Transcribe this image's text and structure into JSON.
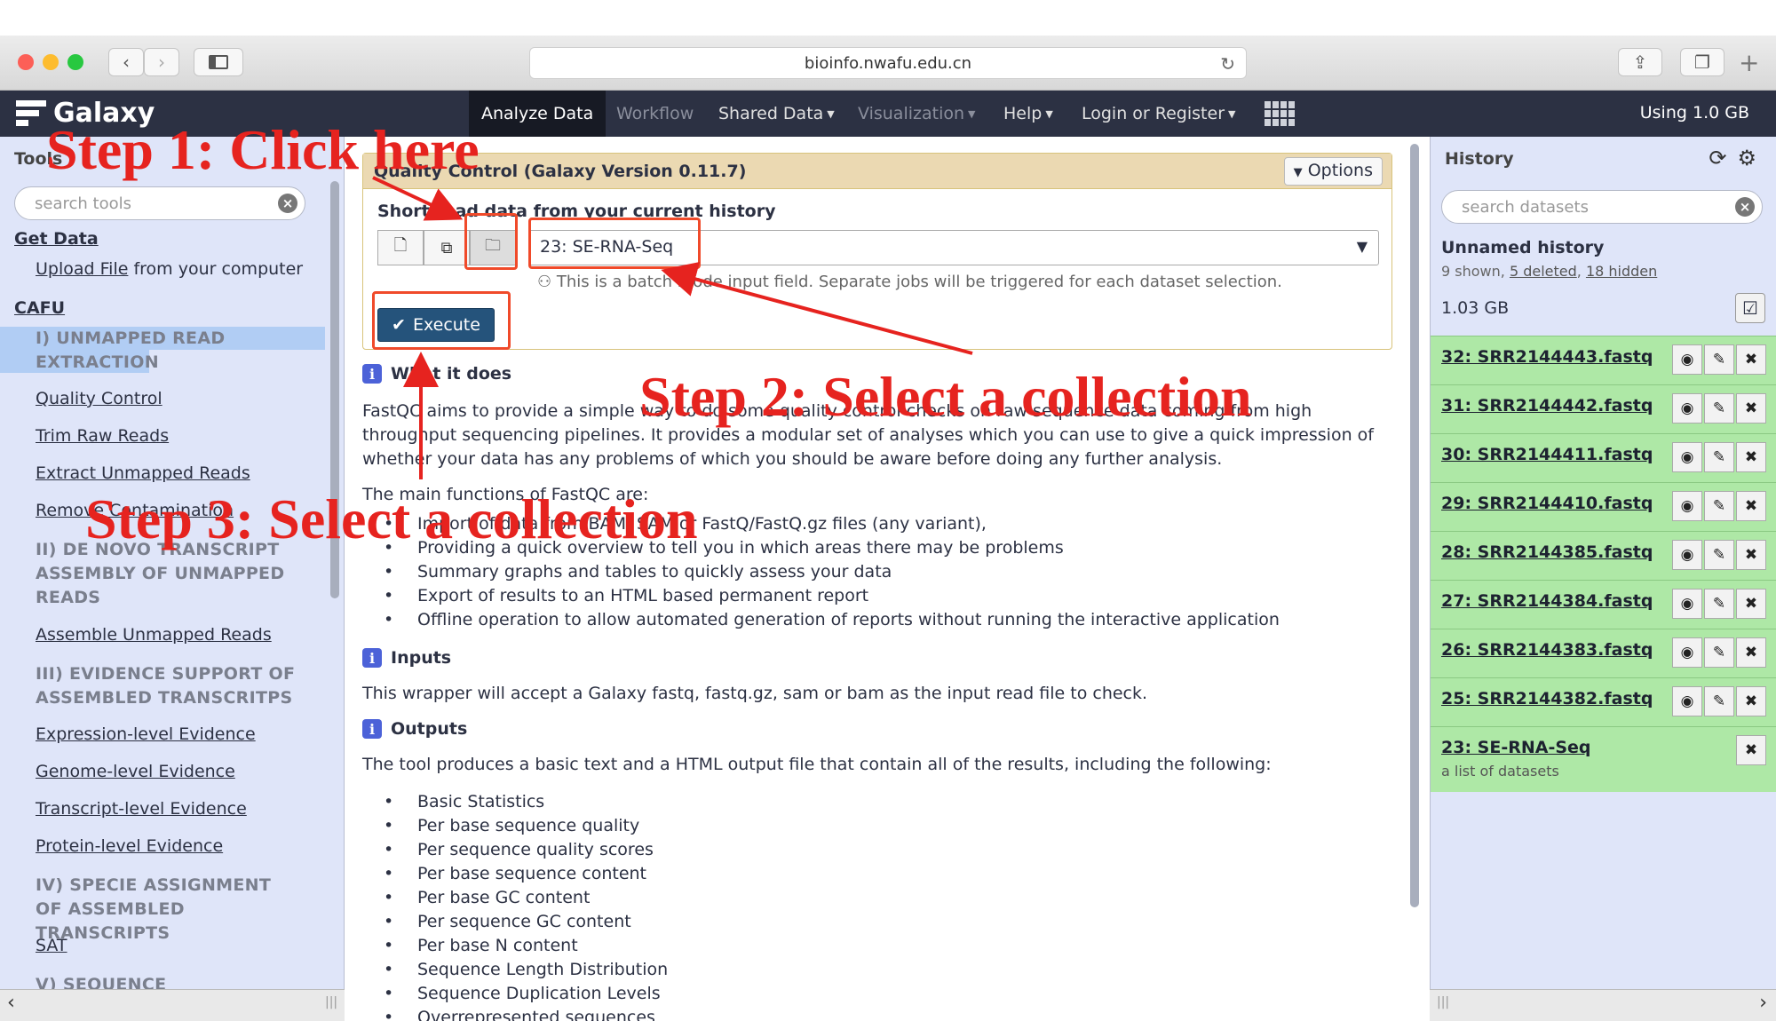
{
  "browser": {
    "url": "bioinfo.nwafu.edu.cn"
  },
  "masthead": {
    "brand": "Galaxy",
    "nav": [
      {
        "label": "Analyze Data"
      },
      {
        "label": "Workflow"
      },
      {
        "label": "Shared Data"
      },
      {
        "label": "Visualization"
      },
      {
        "label": "Help"
      },
      {
        "label": "Login or Register"
      }
    ],
    "usage": "Using 1.0 GB"
  },
  "tools": {
    "title": "Tools",
    "search_placeholder": "search tools",
    "get_data": "Get Data",
    "upload_link": "Upload File",
    "upload_rest": "from your computer",
    "cafu": "CAFU",
    "section1": "I) UNMAPPED READ EXTRACTION",
    "items1": [
      "Quality Control",
      "Trim Raw Reads",
      "Extract Unmapped Reads",
      "Remove Contamination"
    ],
    "section2": "II) DE NOVO TRANSCRIPT ASSEMBLY OF UNMAPPED READS",
    "items2": [
      "Assemble Unmapped Reads"
    ],
    "section3": "III) EVIDENCE SUPPORT OF ASSEMBLED TRANSCRITPS",
    "items3": [
      "Expression-level Evidence",
      "Genome-level Evidence",
      "Transcript-level Evidence",
      "Protein-level Evidence"
    ],
    "section4": "IV) SPECIE ASSIGNMENT OF ASSEMBLED TRANSCRIPTS",
    "items4": [
      "SAT"
    ],
    "section5": "V) SEQUENCE"
  },
  "tool_form": {
    "title": "Quality Control (Galaxy Version 0.11.7)",
    "options": "Options",
    "field_label": "Short read data from your current history",
    "selected": "23: SE-RNA-Seq",
    "batch_note": "This is a batch mode input field. Separate jobs will be triggered for each dataset selection.",
    "execute": "Execute"
  },
  "help": {
    "what_title": "What it does",
    "what_text": "FastQC aims to provide a simple way to do some quality control checks on raw sequence data coming from high throughput sequencing pipelines. It provides a modular set of analyses which you can use to give a quick impression of whether your data has any problems of which you should be aware before doing any further analysis.",
    "main_functions": "The main functions of FastQC are:",
    "functions": [
      "Import of data from BAM, SAM or FastQ/FastQ.gz files (any variant),",
      "Providing a quick overview to tell you in which areas there may be problems",
      "Summary graphs and tables to quickly assess your data",
      "Export of results to an HTML based permanent report",
      "Offline operation to allow automated generation of reports without running the interactive application"
    ],
    "inputs_title": "Inputs",
    "inputs_text": "This wrapper will accept a Galaxy fastq, fastq.gz, sam or bam as the input read file to check.",
    "outputs_title": "Outputs",
    "outputs_text": "The tool produces a basic text and a HTML output file that contain all of the results, including the following:",
    "outputs": [
      "Basic Statistics",
      "Per base sequence quality",
      "Per sequence quality scores",
      "Per base sequence content",
      "Per base GC content",
      "Per sequence GC content",
      "Per base N content",
      "Sequence Length Distribution",
      "Sequence Duplication Levels",
      "Overrepresented sequences"
    ]
  },
  "history": {
    "title": "History",
    "search_placeholder": "search datasets",
    "name": "Unnamed history",
    "shown": "9 shown,",
    "deleted": "5 deleted",
    "hidden": "18 hidden",
    "size": "1.03 GB",
    "datasets": [
      {
        "name": "32: SRR2144443.fastq"
      },
      {
        "name": "31: SRR2144442.fastq"
      },
      {
        "name": "30: SRR2144411.fastq"
      },
      {
        "name": "29: SRR2144410.fastq"
      },
      {
        "name": "28: SRR2144385.fastq"
      },
      {
        "name": "27: SRR2144384.fastq"
      },
      {
        "name": "26: SRR2144383.fastq"
      },
      {
        "name": "25: SRR2144382.fastq"
      }
    ],
    "collection": {
      "name": "23: SE-RNA-Seq",
      "sub": "a list of datasets"
    }
  },
  "annotations": {
    "step1": "Step 1: Click here",
    "step2": "Step 2: Select a collection",
    "step3": "Step 3: Select a collection"
  },
  "colors": {
    "masthead": "#2c3143",
    "panel": "#dfe5f9",
    "dataset_ok": "#aee8a6",
    "annotation": "#e6231f",
    "execute": "#25537b"
  }
}
